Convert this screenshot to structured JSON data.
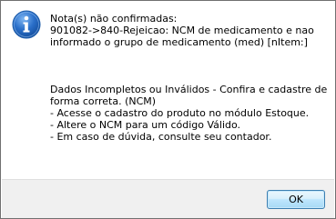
{
  "dialog": {
    "icon": "information-icon",
    "message_lines": [
      "Nota(s) não confirmadas:",
      "901082->840-Rejeicao: NCM de medicamento e nao",
      "informado o grupo de medicamento (med) [nItem:]"
    ],
    "detail_lines": [
      "Dados Incompletos ou Inválidos - Confira e cadastre de",
      "forma correta. (NCM)",
      "-  Acesse o cadastro do produto no módulo Estoque.",
      "-  Altere o NCM para um código Válido.",
      "-  Em caso de dúvida, consulte seu contador."
    ],
    "ok_label": "OK"
  },
  "colors": {
    "icon_blue": "#2a6fc9",
    "footer_bg": "#f0f0f0",
    "button_border": "#3c7fb1"
  }
}
